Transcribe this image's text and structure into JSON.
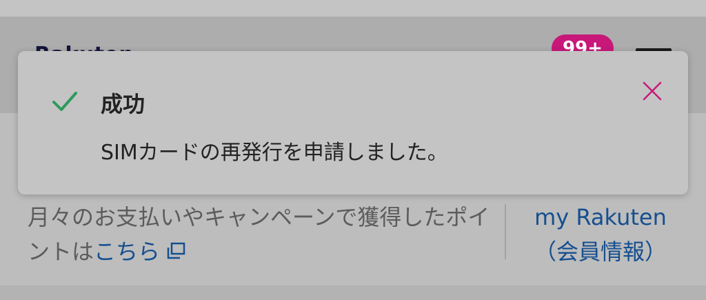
{
  "header": {
    "logo_text": "Rakuten",
    "badge_count": "99+"
  },
  "toast": {
    "title": "成功",
    "message": "SIMカードの再発行を申請しました。",
    "status_color": "#2e9a5c",
    "close_color": "#c8187a",
    "icon": "check-icon"
  },
  "points": {
    "text": "月々のお支払いやキャンペーンで獲得したポイントは",
    "link_label": "こちら",
    "link_icon": "external-link-icon"
  },
  "my_rakuten": {
    "line1": "my Rakuten",
    "line2": "（会員情報）"
  },
  "colors": {
    "accent": "#c8187a",
    "link": "#154f8f"
  }
}
